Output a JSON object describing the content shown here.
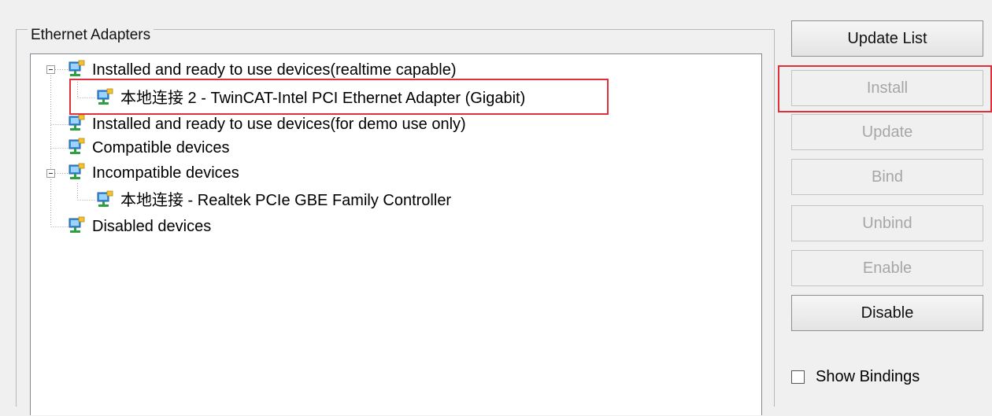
{
  "group": {
    "title": "Ethernet Adapters"
  },
  "tree": {
    "nodes": [
      {
        "label": "Installed and ready to use devices(realtime capable)",
        "expanded": true
      },
      {
        "label": "本地连接 2 - TwinCAT-Intel PCI Ethernet Adapter (Gigabit)",
        "selected_highlight": true
      },
      {
        "label": "Installed and ready to use devices(for demo use only)"
      },
      {
        "label": "Compatible devices"
      },
      {
        "label": "Incompatible devices",
        "expanded": true
      },
      {
        "label": "本地连接 - Realtek PCIe GBE Family Controller"
      },
      {
        "label": "Disabled devices"
      }
    ],
    "icon": "network-adapter-icon"
  },
  "buttons": {
    "update_list": "Update List",
    "install": "Install",
    "update": "Update",
    "bind": "Bind",
    "unbind": "Unbind",
    "enable": "Enable",
    "disable": "Disable"
  },
  "show_bindings": {
    "label": "Show Bindings",
    "checked": false
  },
  "colors": {
    "highlight": "#e0313a",
    "disabled_text": "#a6a6a6"
  }
}
